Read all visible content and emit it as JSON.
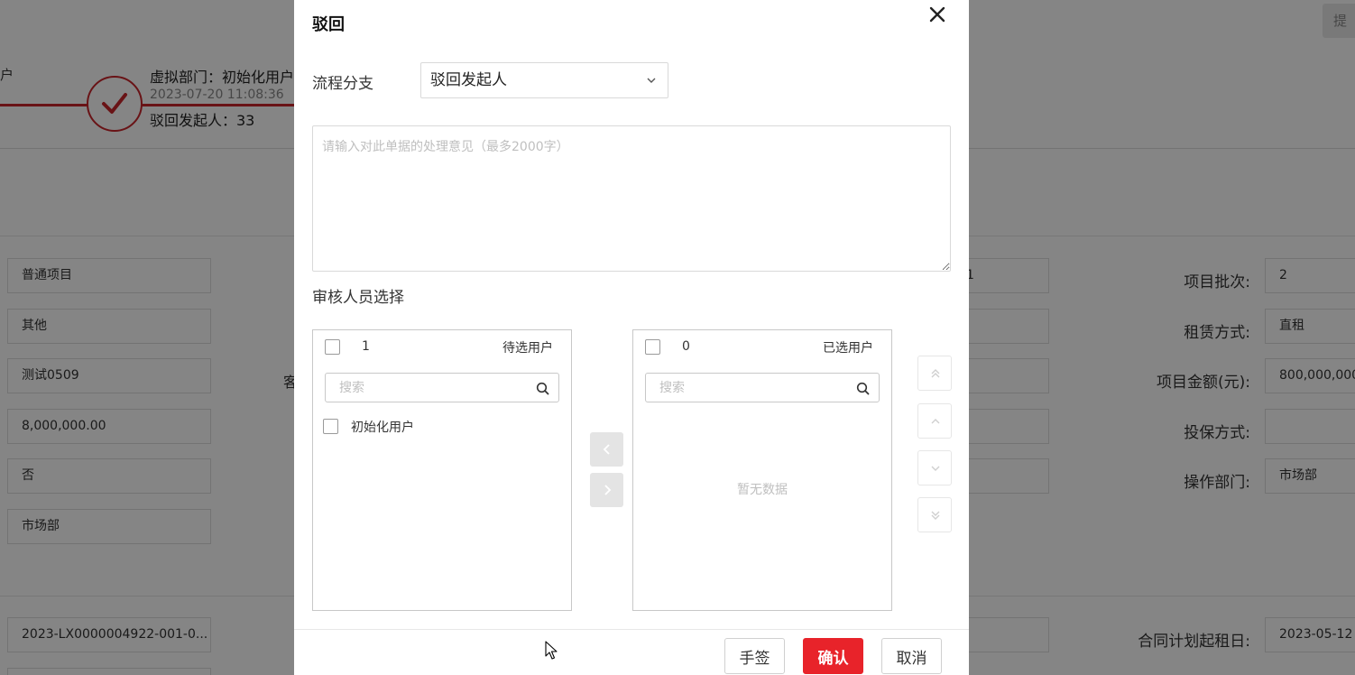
{
  "background": {
    "top_button": "提",
    "user_fragment": "户",
    "step": {
      "dept": "虚拟部门：初始化用户",
      "time": "2023-07-20 11:08:36",
      "rejecter": "驳回发起人：33"
    },
    "left_fields": [
      "普通项目",
      "其他",
      "测试0509",
      "8,000,000.00",
      "否",
      "市场部"
    ],
    "left_bottom_field": "2023-LX0000004922-001-0...",
    "mid_fragment_label": "客",
    "mid_first_value": "1",
    "right_labels": [
      "项目批次:",
      "租赁方式:",
      "项目金额(元):",
      "投保方式:",
      "操作部门:",
      "合同计划起租日:"
    ],
    "right_values": [
      "2",
      "直租",
      "800,000,000.",
      "",
      "市场部",
      "2023-05-12"
    ]
  },
  "modal": {
    "title": "驳回",
    "branch_label": "流程分支",
    "branch_value": "驳回发起人",
    "opinion_placeholder": "请输入对此单据的处理意见（最多2000字）",
    "reviewer_label": "审核人员选择",
    "left_panel": {
      "count": "1",
      "title": "待选用户",
      "search_placeholder": "搜索",
      "items": [
        "初始化用户"
      ]
    },
    "right_panel": {
      "count": "0",
      "title": "已选用户",
      "search_placeholder": "搜索",
      "empty_text": "暂无数据"
    },
    "buttons": {
      "sign": "手签",
      "confirm": "确认",
      "cancel": "取消"
    }
  }
}
